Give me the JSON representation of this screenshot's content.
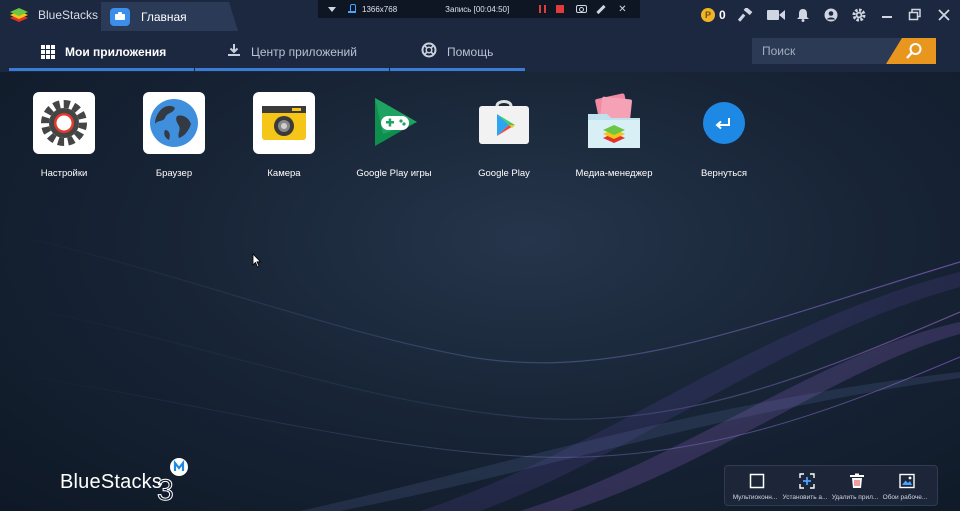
{
  "titlebar": {
    "brand": "BlueStacks",
    "home_tab": "Главная",
    "resolution": "1366x768",
    "recording": "Запись [00:04:50]",
    "coins": "0"
  },
  "nav": {
    "tabs": [
      {
        "label": "Мои приложения"
      },
      {
        "label": "Центр приложений"
      },
      {
        "label": "Помощь"
      }
    ],
    "search_placeholder": "Поиск"
  },
  "apps": [
    {
      "label": "Настройки",
      "icon": "settings-gear-icon"
    },
    {
      "label": "Браузер",
      "icon": "globe-icon"
    },
    {
      "label": "Камера",
      "icon": "camera-icon"
    },
    {
      "label": "Google Play игры",
      "icon": "gamepad-icon"
    },
    {
      "label": "Google Play",
      "icon": "play-store-icon"
    },
    {
      "label": "Медиа-менеджер",
      "icon": "media-folder-icon"
    },
    {
      "label": "Вернуться",
      "icon": "back-arrow-icon"
    }
  ],
  "footer_logo": "BlueStacks",
  "footer_logo_version": "3",
  "dock": [
    {
      "label": "Мультиоконн..."
    },
    {
      "label": "Установить а..."
    },
    {
      "label": "Удалить прил..."
    },
    {
      "label": "Обои рабоче..."
    }
  ],
  "colors": {
    "accent": "#3a7bd5",
    "search_button": "#e8961e",
    "record": "#e23b3b",
    "chrome": "#1c2840"
  }
}
